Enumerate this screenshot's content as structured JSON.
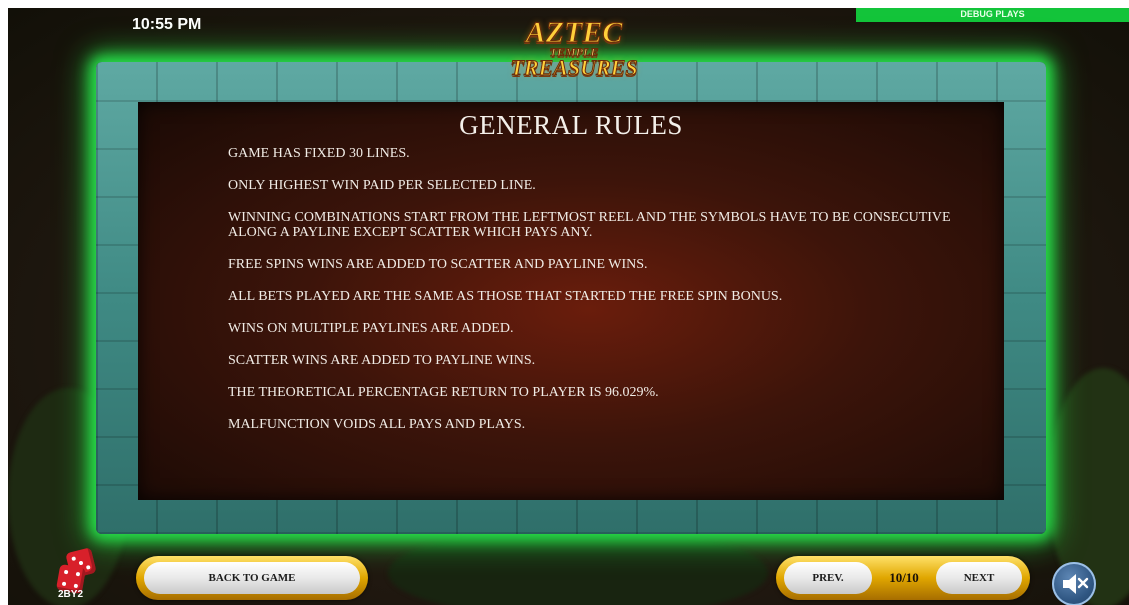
{
  "status_bar": {
    "time": "10:55 PM",
    "debug_label": "DEBUG PLAYS"
  },
  "logo": {
    "line1": "AZTEC",
    "line2": "TEMPLE",
    "line3": "TREASURES"
  },
  "rules_panel": {
    "title": "GENERAL RULES",
    "rules": [
      "Game has fixed 30 lines.",
      "Only highest win paid per selected line.",
      "Winning combinations start from the leftmost reel and the symbols have to be consecutive along a payline except scatter which pays any.",
      "Free spins wins are added to scatter and payline wins.",
      "All bets played are the same as those that started the free spin bonus.",
      "Wins on multiple paylines are added.",
      "Scatter wins are added to payline wins.",
      "The theoretical percentage return to player is 96.029%.",
      "Malfunction voids all pays and plays."
    ]
  },
  "footer": {
    "brand": "2BY2",
    "back_label": "BACK TO GAME",
    "prev_label": "PREV.",
    "page_indicator": "10/10",
    "next_label": "NEXT",
    "sound_icon": "speaker-muted-icon"
  },
  "colors": {
    "frame_glow": "#27e04a",
    "frame_stone": "#4f9a94",
    "panel_bg": "#4a170a",
    "button_gold": "#e0a600",
    "debug_bar": "#13c43a",
    "sound_button": "#2f5682"
  }
}
